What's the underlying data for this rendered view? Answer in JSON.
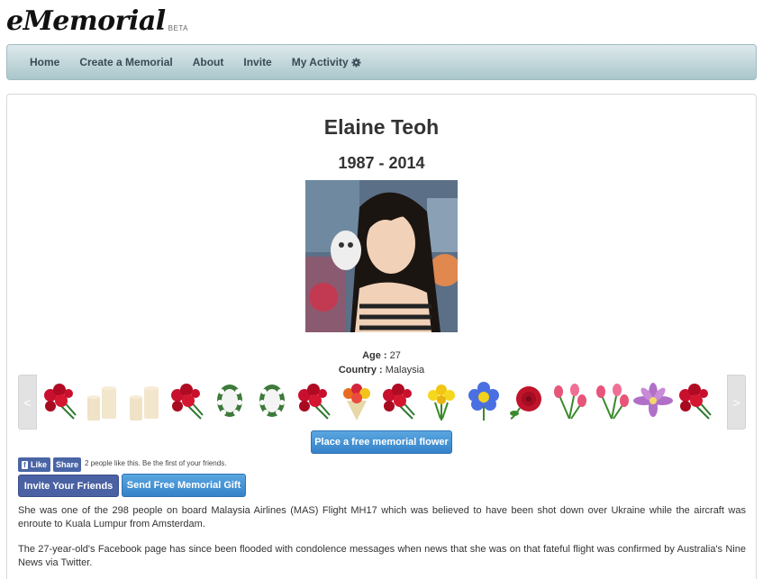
{
  "header": {
    "logo": "eMemorial",
    "beta": "BETA"
  },
  "nav": [
    {
      "label": "Home"
    },
    {
      "label": "Create a Memorial"
    },
    {
      "label": "About"
    },
    {
      "label": "Invite"
    },
    {
      "label": "My Activity"
    }
  ],
  "memorial": {
    "name": "Elaine Teoh",
    "years": "1987 - 2014",
    "age_label": "Age :",
    "age": "27",
    "country_label": "Country :",
    "country": "Malaysia"
  },
  "carousel": {
    "prev": "<",
    "next": ">",
    "items": [
      "red-roses-bouquet",
      "candles",
      "candles",
      "red-roses-bouquet",
      "white-wreath",
      "white-wreath",
      "red-roses-bouquet",
      "mixed-flower-bouquet",
      "red-roses-bouquet",
      "yellow-flowers",
      "blue-flower",
      "red-rose",
      "pink-tulips",
      "pink-tulips",
      "purple-lotus",
      "red-roses-bouquet"
    ]
  },
  "actions": {
    "place_flower": "Place a free memorial flower",
    "fb_like": "Like",
    "fb_share": "Share",
    "like_text": "2 people like this. Be the first of your friends.",
    "invite_friends": "Invite Your Friends",
    "send_gift": "Send Free Memorial Gift"
  },
  "bio": [
    "She was one of the 298 people on board Malaysia Airlines (MAS) Flight MH17 which was believed to have been shot down over Ukraine while the aircraft was enroute to Kuala Lumpur from Amsterdam.",
    "The 27-year-old's Facebook page has since been flooded with condolence messages when news that she was on that fateful flight was confirmed by Australia's Nine News via Twitter."
  ],
  "colors": {
    "navbar": "#a9c7cb",
    "button_blue": "#3582c9",
    "facebook": "#4a61a3"
  }
}
